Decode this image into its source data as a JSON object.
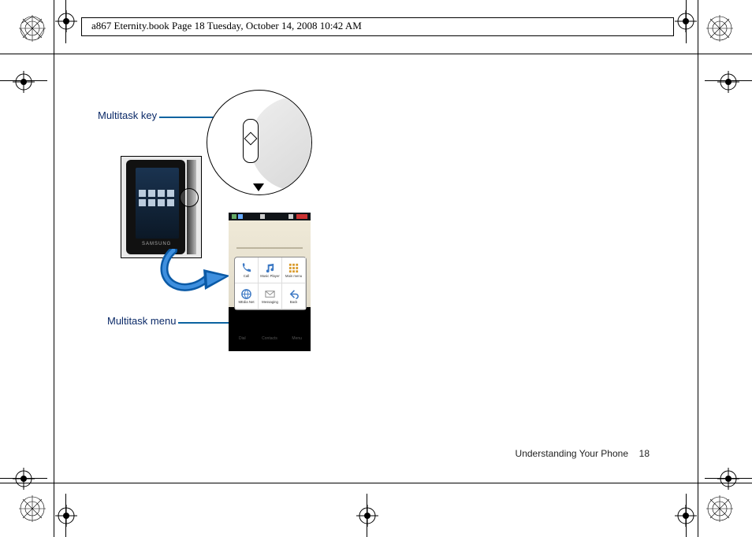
{
  "header_line": "a867 Eternity.book  Page 18  Tuesday, October 14, 2008  10:42 AM",
  "labels": {
    "multitask_key": "Multitask key",
    "multitask_menu": "Multitask menu"
  },
  "phone_thumb": {
    "brand": "SAMSUNG"
  },
  "multitask_popup": {
    "items": [
      {
        "id": "call",
        "label": "Call"
      },
      {
        "id": "music",
        "label": "Music Player"
      },
      {
        "id": "mainmenu",
        "label": "Main menu"
      },
      {
        "id": "medianet",
        "label": "MEdia Net"
      },
      {
        "id": "messaging",
        "label": "Messaging"
      },
      {
        "id": "back",
        "label": "Back"
      }
    ]
  },
  "softkeys": {
    "left": "Dial",
    "center": "Contacts",
    "right": "Menu"
  },
  "footer": {
    "section": "Understanding Your Phone",
    "page_no": "18"
  }
}
